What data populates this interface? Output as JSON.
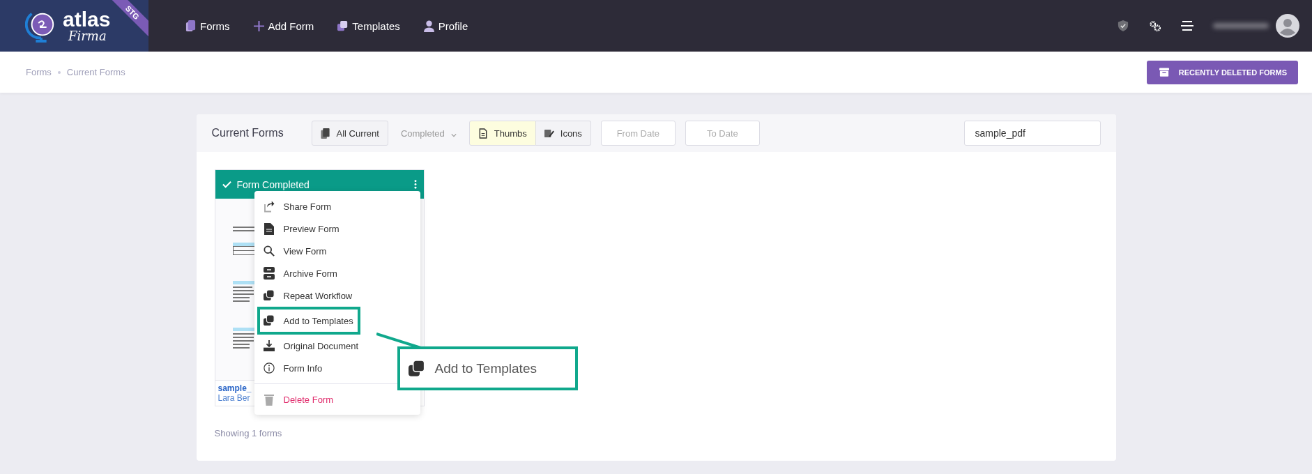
{
  "logo": {
    "name": "atlas",
    "sub": "Firma",
    "badge": "STG"
  },
  "nav": [
    {
      "label": "Forms"
    },
    {
      "label": "Add Form"
    },
    {
      "label": "Templates"
    },
    {
      "label": "Profile"
    }
  ],
  "breadcrumb": [
    "Forms",
    "Current Forms"
  ],
  "recently_deleted_button": "RECENTLY DELETED FORMS",
  "toolbar": {
    "title": "Current Forms",
    "filters": [
      {
        "kind": "button",
        "label": "All Current",
        "selected": false
      },
      {
        "kind": "dropdown",
        "label": "Completed",
        "selected": false
      },
      {
        "kind": "button",
        "label": "Thumbs",
        "selected": true
      },
      {
        "kind": "button",
        "label": "Icons",
        "selected": false
      }
    ],
    "from_date": {
      "placeholder": "From Date"
    },
    "to_date": {
      "placeholder": "To Date"
    },
    "search": {
      "value": "sample_pdf"
    }
  },
  "form_card": {
    "status": "Form Completed",
    "name": "sample_",
    "owner": "Lara Ber"
  },
  "menu": [
    {
      "label": "Share Form",
      "kind": "normal",
      "highlighted": false
    },
    {
      "label": "Preview Form",
      "kind": "normal",
      "highlighted": false
    },
    {
      "label": "View Form",
      "kind": "normal",
      "highlighted": false
    },
    {
      "label": "Archive Form",
      "kind": "normal",
      "highlighted": false
    },
    {
      "label": "Repeat Workflow",
      "kind": "normal",
      "highlighted": false
    },
    {
      "label": "Add to Templates",
      "kind": "normal",
      "highlighted": true
    },
    {
      "label": "Original Document",
      "kind": "normal",
      "highlighted": false
    },
    {
      "label": "Form Info",
      "kind": "normal",
      "highlighted": false
    },
    {
      "label": "Delete Form",
      "kind": "danger",
      "highlighted": false
    }
  ],
  "callout": {
    "label": "Add to Templates"
  },
  "footer": "Showing 1 forms"
}
